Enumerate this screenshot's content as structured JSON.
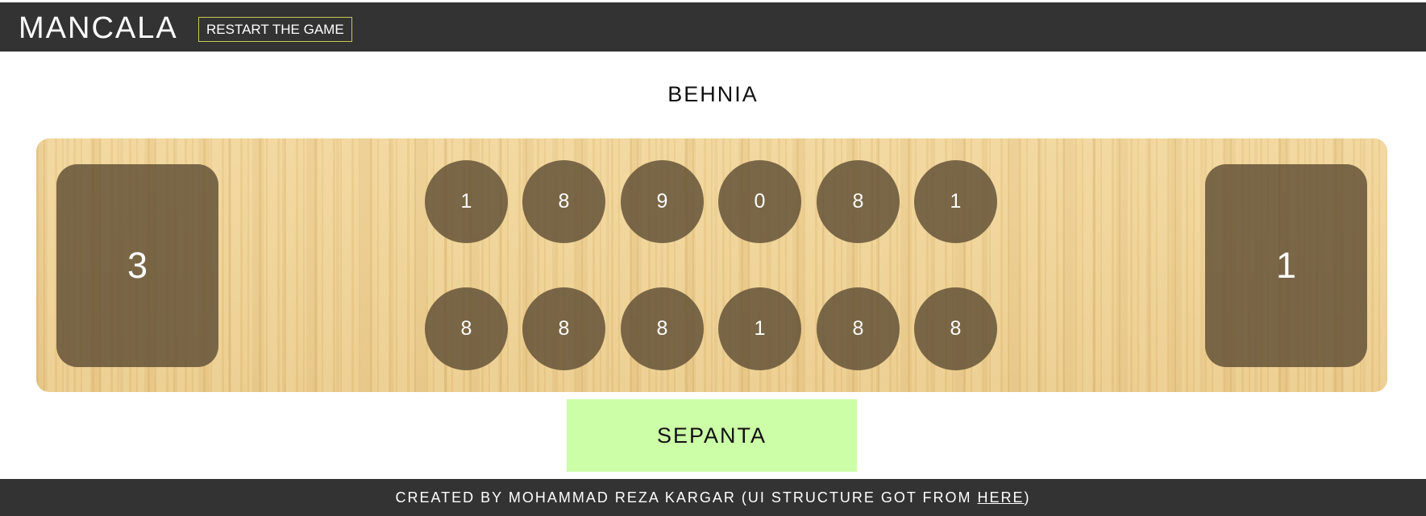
{
  "header": {
    "title": "MANCALA",
    "restart_label": "RESTART THE GAME"
  },
  "players": {
    "top": "BEHNIA",
    "bottom": "SEPANTA"
  },
  "board": {
    "left_store": "3",
    "right_store": "1",
    "top_row": [
      "1",
      "8",
      "9",
      "0",
      "8",
      "1"
    ],
    "bottom_row": [
      "8",
      "8",
      "8",
      "1",
      "8",
      "8"
    ]
  },
  "footer": {
    "text_before": "CREATED BY MOHAMMAD REZA KARGAR (UI STRUCTURE GOT FROM ",
    "link_label": "HERE",
    "text_after": ")"
  },
  "colors": {
    "header_bg": "#333333",
    "pit_color": "#5f4e34",
    "board_wood": "#eccf93",
    "active_player_bg": "#ccfda7",
    "restart_border": "#c8c85a"
  }
}
